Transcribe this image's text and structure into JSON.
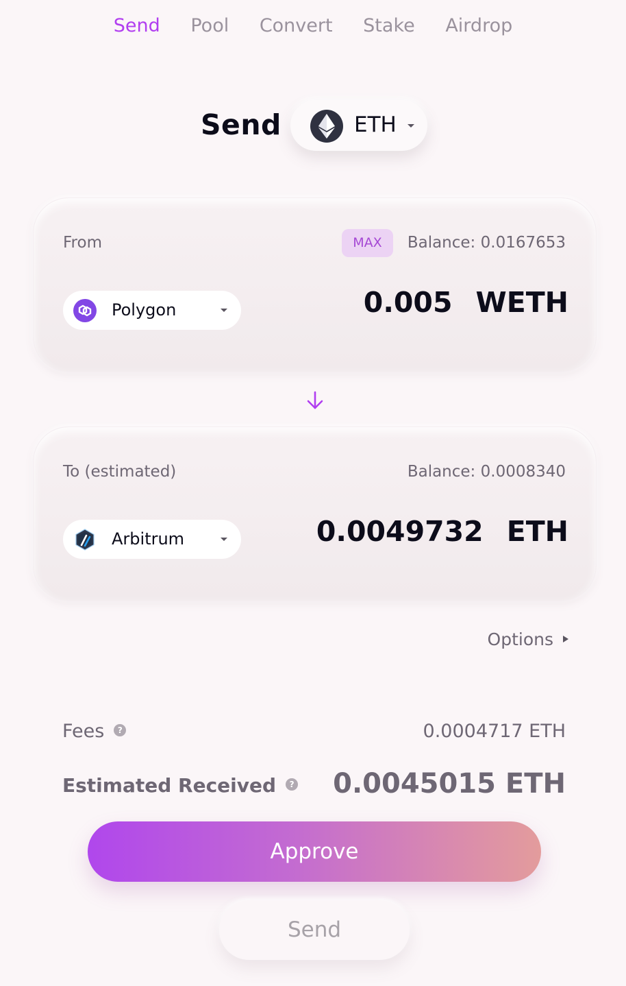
{
  "nav": {
    "tabs": [
      {
        "label": "Send",
        "active": true
      },
      {
        "label": "Pool",
        "active": false
      },
      {
        "label": "Convert",
        "active": false
      },
      {
        "label": "Stake",
        "active": false
      },
      {
        "label": "Airdrop",
        "active": false
      }
    ]
  },
  "header": {
    "title": "Send",
    "token": {
      "label": "ETH",
      "icon": "ethereum-icon"
    }
  },
  "from": {
    "label": "From",
    "max_label": "MAX",
    "balance": "Balance: 0.0167653",
    "chain": {
      "name": "Polygon",
      "icon": "polygon-icon",
      "color": "#8247e5"
    },
    "amount": "0.005",
    "unit": "WETH"
  },
  "to": {
    "label": "To (estimated)",
    "balance": "Balance: 0.0008340",
    "chain": {
      "name": "Arbitrum",
      "icon": "arbitrum-icon",
      "color": "#28a0f0"
    },
    "amount": "0.0049732",
    "unit": "ETH"
  },
  "options": {
    "label": "Options"
  },
  "fees": {
    "label": "Fees",
    "value": "0.0004717 ETH"
  },
  "estimated_received": {
    "label": "Estimated Received",
    "value": "0.0045015 ETH"
  },
  "help_glyph": "?",
  "buttons": {
    "approve": "Approve",
    "send": "Send"
  },
  "colors": {
    "accent": "#b13ef0",
    "max_bg": "#ecd3f4",
    "text_muted": "#6e6774"
  }
}
